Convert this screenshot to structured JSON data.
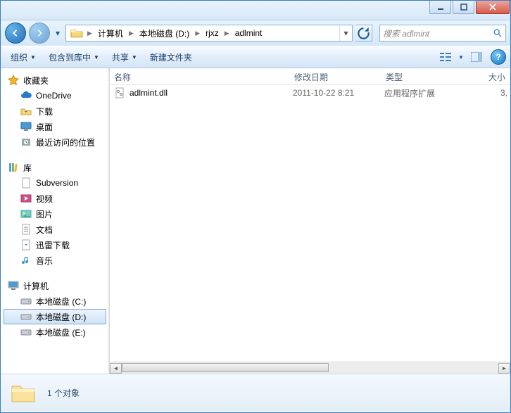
{
  "breadcrumb": [
    "计算机",
    "本地磁盘 (D:)",
    "rjxz",
    "adlmint"
  ],
  "search_placeholder": "搜索 adlmint",
  "toolbar": {
    "organize": "组织",
    "include": "包含到库中",
    "share": "共享",
    "newfolder": "新建文件夹"
  },
  "columns": {
    "name": "名称",
    "modified": "修改日期",
    "type": "类型",
    "size": "大小"
  },
  "files": [
    {
      "name": "adlmint.dll",
      "modified": "2011-10-22 8:21",
      "type": "应用程序扩展",
      "size": "3,"
    }
  ],
  "nav": {
    "favorites": "收藏夹",
    "fav_items": [
      "OneDrive",
      "下载",
      "桌面",
      "最近访问的位置"
    ],
    "libraries": "库",
    "lib_items": [
      "Subversion",
      "视频",
      "图片",
      "文档",
      "迅雷下载",
      "音乐"
    ],
    "computer": "计算机",
    "drives": [
      "本地磁盘 (C:)",
      "本地磁盘 (D:)",
      "本地磁盘 (E:)"
    ]
  },
  "status": "1 个对象"
}
